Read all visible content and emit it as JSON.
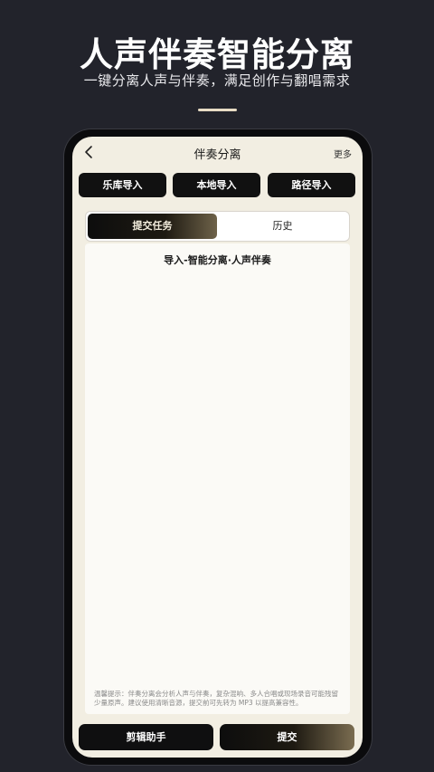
{
  "promo": {
    "title": "人声伴奏智能分离",
    "subtitle": "一键分离人声与伴奏，满足创作与翻唱需求"
  },
  "nav": {
    "title": "伴奏分离",
    "more_label": "更多",
    "back_icon": "chevron-left-icon"
  },
  "import_buttons": [
    {
      "label": "乐库导入"
    },
    {
      "label": "本地导入"
    },
    {
      "label": "路径导入"
    }
  ],
  "tabs": [
    {
      "label": "提交任务",
      "active": true
    },
    {
      "label": "历史",
      "active": false
    }
  ],
  "content": {
    "section_label": "导入-智能分离·人声伴奏",
    "tip": "温馨提示：伴奏分离会分析人声与伴奏，复杂混响、多人合唱或现场录音可能残留少量原声。建议使用清晰音源，提交前可先转为 MP3 以提高兼容性。"
  },
  "bottom_buttons": {
    "edit_label": "剪辑助手",
    "submit_label": "提交"
  },
  "colors": {
    "background": "#22232b",
    "screen": "#f2eee2",
    "accent_gold": "#7a6c50",
    "button_dark": "#111111"
  }
}
